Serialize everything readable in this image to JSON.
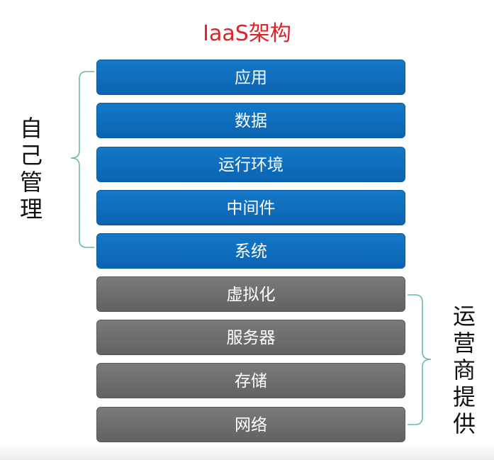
{
  "title": "IaaS架构",
  "self_managed": {
    "label": "自己管理",
    "layers": [
      "应用",
      "数据",
      "运行环境",
      "中间件",
      "系统"
    ]
  },
  "provider_managed": {
    "label": "运营商提供",
    "layers": [
      "虚拟化",
      "服务器",
      "存储",
      "网络"
    ]
  },
  "colors": {
    "title": "#d9242b",
    "self_layer": "#0b6cbb",
    "provider_layer": "#6e6e6e",
    "bracket": "#6fba9a"
  }
}
